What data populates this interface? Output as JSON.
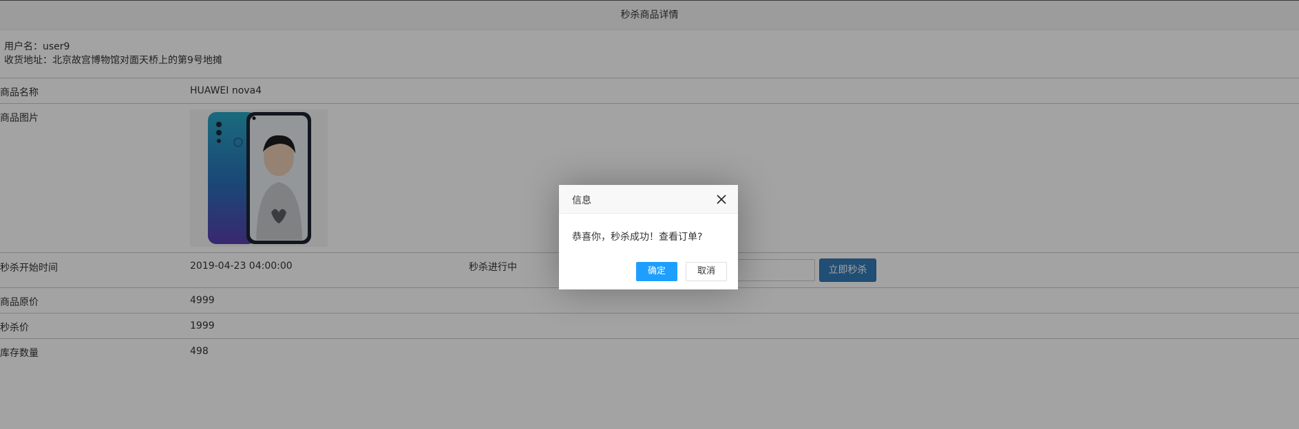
{
  "header": {
    "title": "秒杀商品详情"
  },
  "user": {
    "username_line": "用户名：user9",
    "address_line": "收货地址：北京故宫博物馆对面天桥上的第9号地摊"
  },
  "product": {
    "name_label": "商品名称",
    "name_value": "HUAWEI nova4",
    "image_label": "商品图片",
    "start_label": "秒杀开始时间",
    "start_value": "2019-04-23 04:00:00",
    "status_text": "秒杀进行中",
    "buy_button_label": "立即秒杀",
    "price_label": "商品原价",
    "price_value": "4999",
    "seckill_price_label": "秒杀价",
    "seckill_price_value": "1999",
    "stock_label": "库存数量",
    "stock_value": "498"
  },
  "dialog": {
    "title": "信息",
    "message": "恭喜你，秒杀成功！查看订单?",
    "ok_label": "确定",
    "cancel_label": "取消"
  },
  "icons": {
    "close": "close-icon"
  },
  "colors": {
    "primary_button": "#1e9fff",
    "buy_button": "#337ab7",
    "overlay": "rgba(0,0,0,0.36)"
  }
}
